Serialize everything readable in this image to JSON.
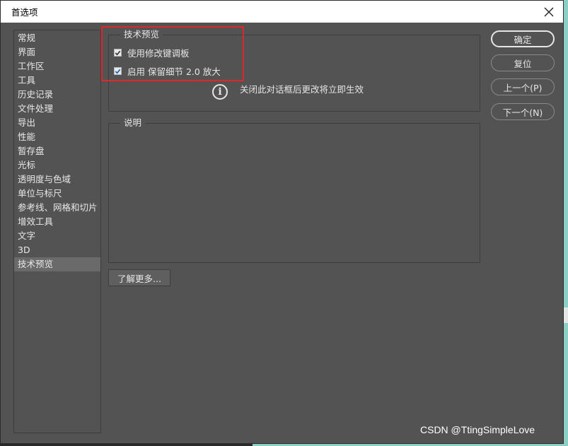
{
  "window": {
    "title": "首选项"
  },
  "sidebar": {
    "items": [
      {
        "label": "常规"
      },
      {
        "label": "界面"
      },
      {
        "label": "工作区"
      },
      {
        "label": "工具"
      },
      {
        "label": "历史记录"
      },
      {
        "label": "文件处理"
      },
      {
        "label": "导出"
      },
      {
        "label": "性能"
      },
      {
        "label": "暂存盘"
      },
      {
        "label": "光标"
      },
      {
        "label": "透明度与色域"
      },
      {
        "label": "单位与标尺"
      },
      {
        "label": "参考线、网格和切片"
      },
      {
        "label": "增效工具"
      },
      {
        "label": "文字"
      },
      {
        "label": "3D"
      },
      {
        "label": "技术预览",
        "selected": true
      }
    ]
  },
  "tech_preview": {
    "legend": "技术预览",
    "option1": {
      "label": "使用修改键调板",
      "checked": true
    },
    "option2": {
      "label": "启用 保留细节 2.0 放大",
      "checked": true
    },
    "info": "关闭此对话框后更改将立即生效"
  },
  "description": {
    "legend": "说明"
  },
  "learn_more": "了解更多...",
  "buttons": {
    "ok": "确定",
    "reset": "复位",
    "prev": "上一个(P)",
    "next": "下一个(N)"
  },
  "watermark": "CSDN @TtingSimpleLove",
  "colors": {
    "dialog_bg": "#535353",
    "highlight": "#e02828",
    "selected_item": "#6a6a6a"
  }
}
